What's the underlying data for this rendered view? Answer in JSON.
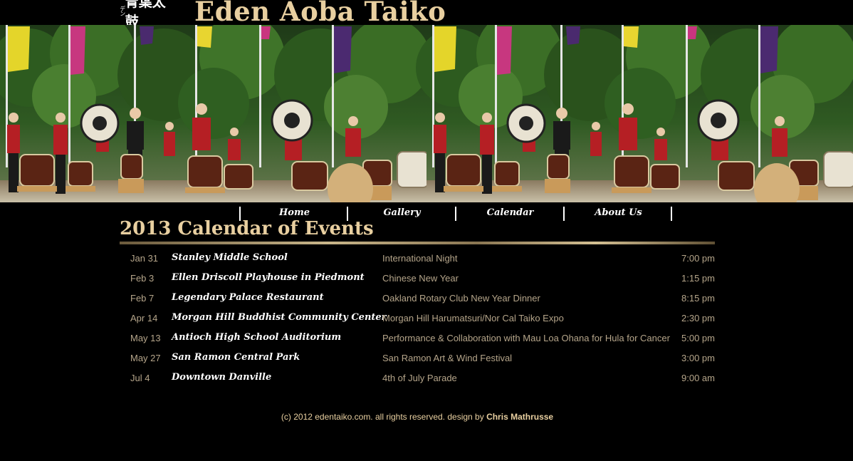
{
  "header": {
    "logo_vertical_text": "デン",
    "logo_kanji": "青葉太鼓",
    "site_title": "Eden Aoba Taiko"
  },
  "nav": {
    "items": [
      {
        "label": "Home"
      },
      {
        "label": "Gallery"
      },
      {
        "label": "Calendar"
      },
      {
        "label": "About Us"
      }
    ]
  },
  "calendar": {
    "title": "2013 Calendar of Events",
    "events": [
      {
        "date": "Jan 31",
        "venue": "Stanley Middle School",
        "event": "International Night",
        "time": "7:00 pm"
      },
      {
        "date": "Feb 3",
        "venue": "Ellen Driscoll Playhouse in Piedmont",
        "event": "Chinese New Year",
        "time": "1:15 pm"
      },
      {
        "date": "Feb 7",
        "venue": "Legendary Palace Restaurant",
        "event": "Oakland Rotary Club New Year Dinner",
        "time": "8:15 pm"
      },
      {
        "date": "Apr 14",
        "venue": "Morgan Hill Buddhist Community Center",
        "event": "Morgan Hill Harumatsuri/Nor Cal Taiko Expo",
        "time": "2:30 pm"
      },
      {
        "date": "May 13",
        "venue": "Antioch High School Auditorium",
        "event": "Performance & Collaboration with Mau Loa Ohana for Hula for Cancer",
        "time": "5:00 pm"
      },
      {
        "date": "May 27",
        "venue": "San Ramon Central Park",
        "event": "San Ramon Art & Wind Festival",
        "time": "3:00 pm"
      },
      {
        "date": "Jul 4",
        "venue": "Downtown Danville",
        "event": "4th of July Parade",
        "time": "9:00 am"
      }
    ]
  },
  "footer": {
    "copyright": "(c) 2012 edentaiko.com. all rights reserved. design by",
    "author": "Chris Mathrusse"
  },
  "colors": {
    "background": "#000000",
    "accent_gold": "#e8cfa0",
    "muted_text": "#b5a58a"
  }
}
